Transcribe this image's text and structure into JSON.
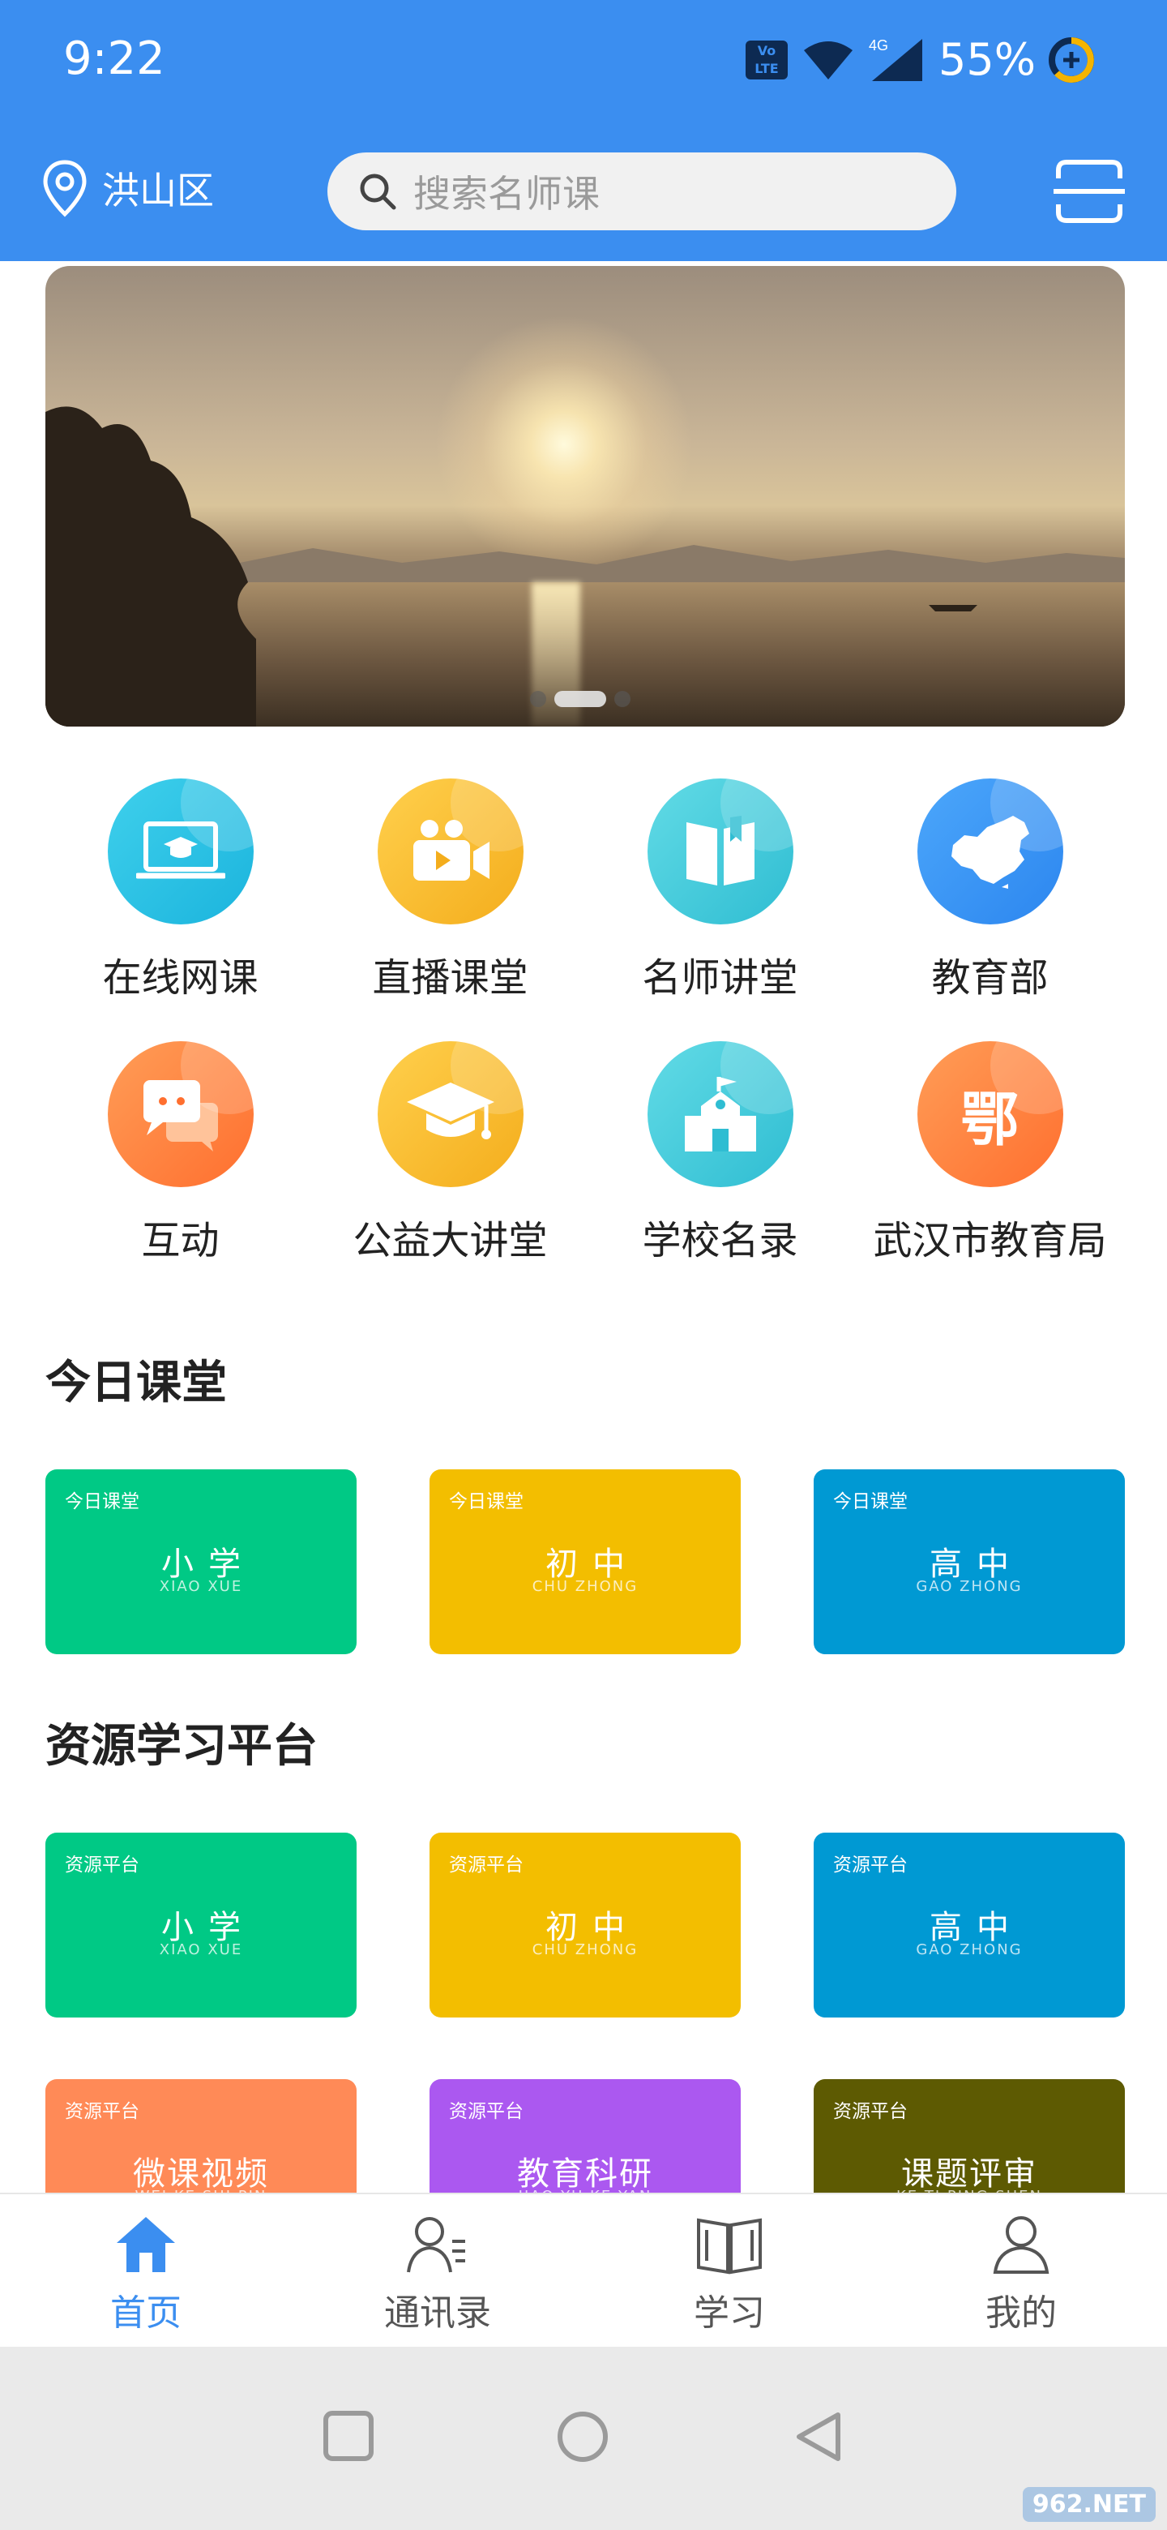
{
  "status_bar": {
    "time": "9:22",
    "volte_label": "Vo LTE",
    "network": "4G",
    "battery": "55%"
  },
  "header": {
    "location": "洪山区",
    "search_placeholder": "搜索名师课",
    "accent_color": "#3b8ef0"
  },
  "banner": {
    "slide_count": 3,
    "active_slide": 2
  },
  "features": [
    {
      "label": "在线网课",
      "icon": "laptop-graduation-icon"
    },
    {
      "label": "直播课堂",
      "icon": "video-camera-icon"
    },
    {
      "label": "名师讲堂",
      "icon": "open-book-icon"
    },
    {
      "label": "教育部",
      "icon": "china-map-icon"
    },
    {
      "label": "互动",
      "icon": "chat-bubbles-icon"
    },
    {
      "label": "公益大讲堂",
      "icon": "graduation-cap-icon"
    },
    {
      "label": "学校名录",
      "icon": "school-building-icon"
    },
    {
      "label": "武汉市教育局",
      "icon": "e-character-icon",
      "glyph": "鄂"
    }
  ],
  "today": {
    "title": "今日课堂",
    "cards": [
      {
        "tag": "今日课堂",
        "main": "小学",
        "pinyin": "XIAO XUE",
        "color": "#00c985"
      },
      {
        "tag": "今日课堂",
        "main": "初中",
        "pinyin": "CHU ZHONG",
        "color": "#f3be00"
      },
      {
        "tag": "今日课堂",
        "main": "高中",
        "pinyin": "GAO ZHONG",
        "color": "#0099d3"
      }
    ]
  },
  "resources": {
    "title": "资源学习平台",
    "cards": [
      {
        "tag": "资源平台",
        "main": "小学",
        "pinyin": "XIAO XUE",
        "color": "#00c985"
      },
      {
        "tag": "资源平台",
        "main": "初中",
        "pinyin": "CHU ZHONG",
        "color": "#f3be00"
      },
      {
        "tag": "资源平台",
        "main": "高中",
        "pinyin": "GAO ZHONG",
        "color": "#0099d3"
      },
      {
        "tag": "资源平台",
        "main": "微课视频",
        "pinyin": "WEI KE SHI PIN",
        "color": "#ff8a57"
      },
      {
        "tag": "资源平台",
        "main": "教育科研",
        "pinyin": "JIAO YU KE YAN",
        "color": "#ab58f0"
      },
      {
        "tag": "资源平台",
        "main": "课题评审",
        "pinyin": "KE TI PING SHEN",
        "color": "#5d5a02"
      }
    ]
  },
  "bottom_nav": [
    {
      "label": "首页",
      "icon": "home-icon",
      "active": true
    },
    {
      "label": "通讯录",
      "icon": "contacts-icon",
      "active": false
    },
    {
      "label": "学习",
      "icon": "book-icon",
      "active": false
    },
    {
      "label": "我的",
      "icon": "user-icon",
      "active": false
    }
  ],
  "watermark": "962.NET"
}
